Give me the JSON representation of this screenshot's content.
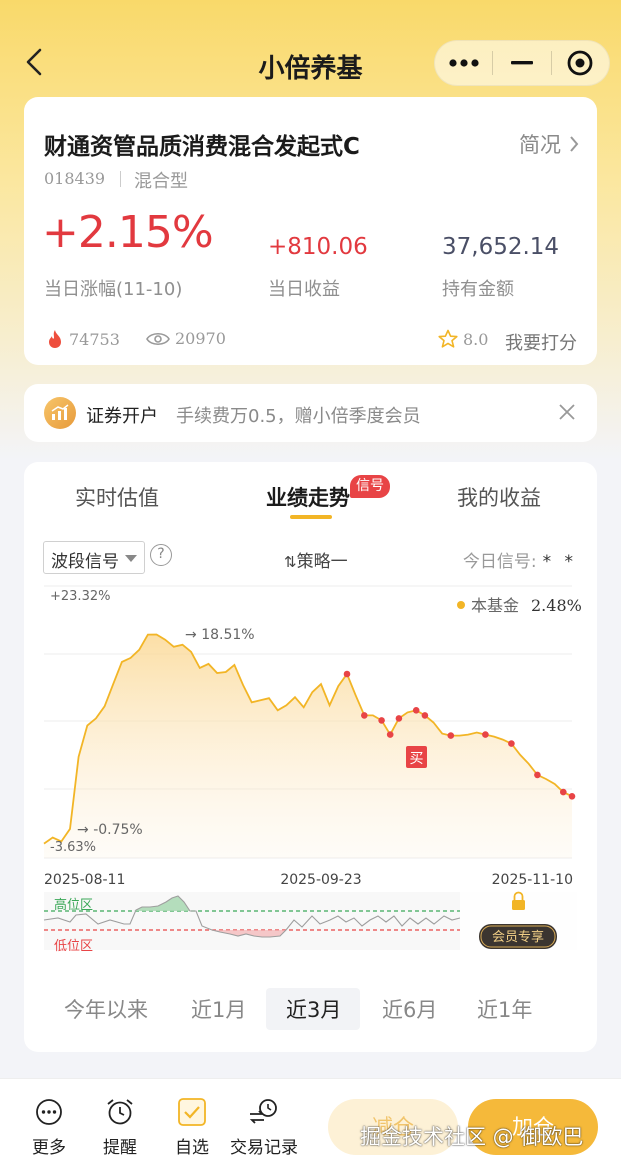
{
  "header": {
    "title": "小倍养基"
  },
  "fund": {
    "name": "财通资管品质消费混合发起式C",
    "brief_link": "简况",
    "code": "018439",
    "type": "混合型",
    "daily_change": "+2.15%",
    "daily_change_label": "当日涨幅(11-10)",
    "daily_profit": "+810.06",
    "daily_profit_label": "当日收益",
    "holding": "37,652.14",
    "holding_label": "持有金额",
    "heat": "74753",
    "views": "20970",
    "rating": "8.0",
    "rate_label": "我要打分"
  },
  "promo": {
    "title": "证券开户",
    "desc": "手续费万0.5，赠小倍季度会员"
  },
  "tabs": [
    {
      "label": "实时估值"
    },
    {
      "label": "业绩走势"
    },
    {
      "label": "我的收益"
    }
  ],
  "tab_badge": "信号",
  "controls": {
    "select_value": "波段信号",
    "help_symbol": "?",
    "strategy": "策略一",
    "today_signal_label": "今日信号:",
    "today_signal_value": "* *"
  },
  "chart_data": {
    "type": "line",
    "x_start": "2025-08-11",
    "x_end": "2025-11-10",
    "x_ticks": [
      "2025-08-11",
      "2025-09-23",
      "2025-11-10"
    ],
    "y_top_label": "+23.32%",
    "y_bottom_label": "-3.63%",
    "ylim": [
      -3.63,
      23.32
    ],
    "legend": {
      "name": "本基金",
      "value": "2.48%"
    },
    "annotations": {
      "max": "18.51%",
      "min": "-0.75%",
      "buy_marker": "买"
    },
    "series": [
      {
        "values": [
          -2.2,
          -1.6,
          -2.0,
          -0.75,
          6.4,
          9.5,
          10.2,
          11.4,
          13.6,
          15.8,
          16.2,
          17.0,
          18.5,
          18.51,
          18.0,
          17.3,
          17.5,
          16.8,
          15.2,
          15.6,
          14.7,
          14.8,
          15.5,
          13.5,
          11.8,
          12.0,
          12.2,
          11.0,
          11.5,
          12.3,
          11.3,
          12.8,
          13.6,
          11.5,
          13.4,
          14.6,
          12.5,
          10.5,
          10.5,
          10.0,
          8.6,
          10.2,
          10.8,
          11.0,
          10.5,
          9.8,
          8.7,
          8.5,
          8.5,
          8.6,
          8.8,
          8.6,
          8.4,
          8.1,
          7.7,
          6.6,
          5.7,
          4.6,
          4.2,
          3.7,
          2.9,
          2.48
        ]
      }
    ],
    "signal_zones": {
      "high_label": "高位区",
      "low_label": "低位区"
    },
    "member_button": "会员专享"
  },
  "ranges": [
    {
      "label": "今年以来"
    },
    {
      "label": "近1月"
    },
    {
      "label": "近3月"
    },
    {
      "label": "近6月"
    },
    {
      "label": "近1年"
    }
  ],
  "bottom_nav": [
    {
      "label": "更多",
      "icon": "more-icon"
    },
    {
      "label": "提醒",
      "icon": "alarm-icon"
    },
    {
      "label": "自选",
      "icon": "checkbox-icon"
    },
    {
      "label": "交易记录",
      "icon": "trade-record-icon"
    }
  ],
  "actions": {
    "reduce": "减仓",
    "add": "加仓"
  },
  "watermark": "掘金技术社区 @ 御欧巴",
  "colors": {
    "accent": "#f5b93a",
    "up": "#e2393f",
    "line": "#f2b526"
  }
}
